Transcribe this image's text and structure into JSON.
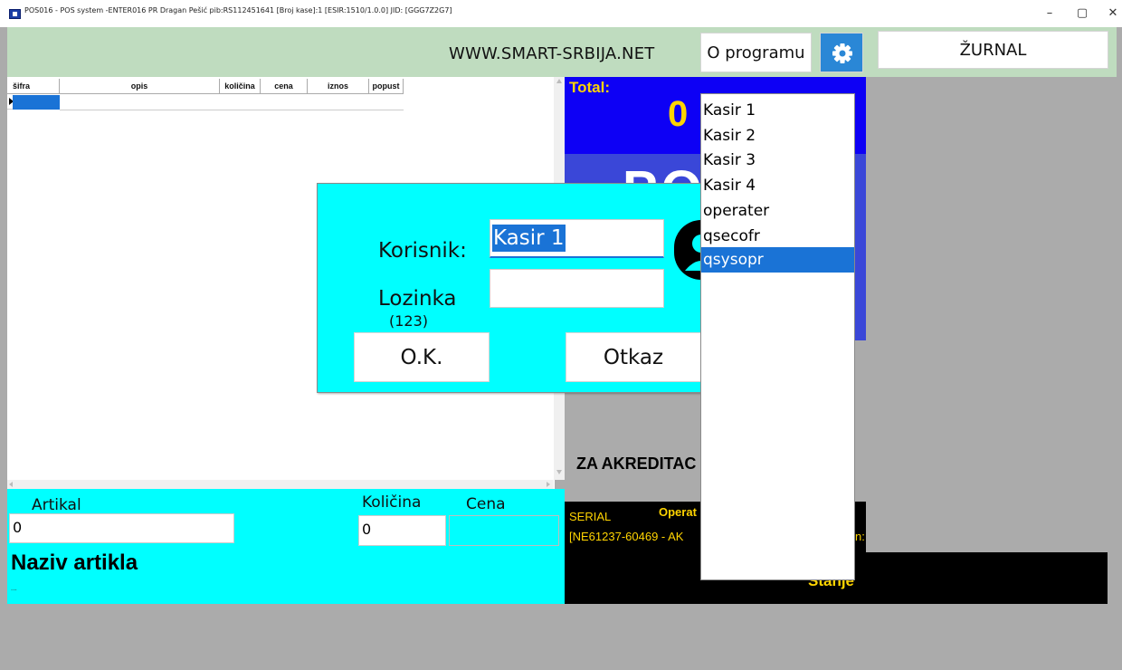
{
  "window": {
    "title": "POS016 - POS system -ENTER016 PR Dragan Pešić  pib:RS112451641     [Broj kase]:1     [ESIR:1510/1.0.0]  JID: [GGG7Z2G7]",
    "minimize": "–",
    "maximize": "▢",
    "close": "✕"
  },
  "header": {
    "website": "WWW.SMART-SRBIJA.NET",
    "about_label": "O programu",
    "journal_label": "ŽURNAL"
  },
  "table": {
    "columns": [
      "šifra",
      "opis",
      "količina",
      "cena",
      "iznos",
      "popust"
    ]
  },
  "entry": {
    "article_label": "Artikal",
    "article_value": "0",
    "quantity_label": "Količina",
    "quantity_value": "0",
    "price_label": "Cena",
    "price_value": "",
    "article_name_label": "Naziv artikla",
    "article_name_value": "..."
  },
  "right": {
    "total_label": "Total:",
    "total_value": "0",
    "pos_text": "POS",
    "accreditation_text": "ZA AKREDITAC",
    "serial_label": "SERIAL",
    "operator_label": "Operat",
    "serial_value": "[NE61237-60469 - AK",
    "serial_suffix": "n:",
    "state_text": "Stanje"
  },
  "login": {
    "user_label": "Korisnik:",
    "user_value": "Kasir 1",
    "password_label": "Lozinka",
    "password_hint": "(123)",
    "ok_label": "O.K.",
    "cancel_label": "Otkaz"
  },
  "user_list": {
    "items": [
      "Kasir 1",
      "Kasir 2",
      "Kasir 3",
      "Kasir 4",
      "operater",
      "qsecofr",
      "qsysopr"
    ],
    "selected": "qsysopr"
  }
}
